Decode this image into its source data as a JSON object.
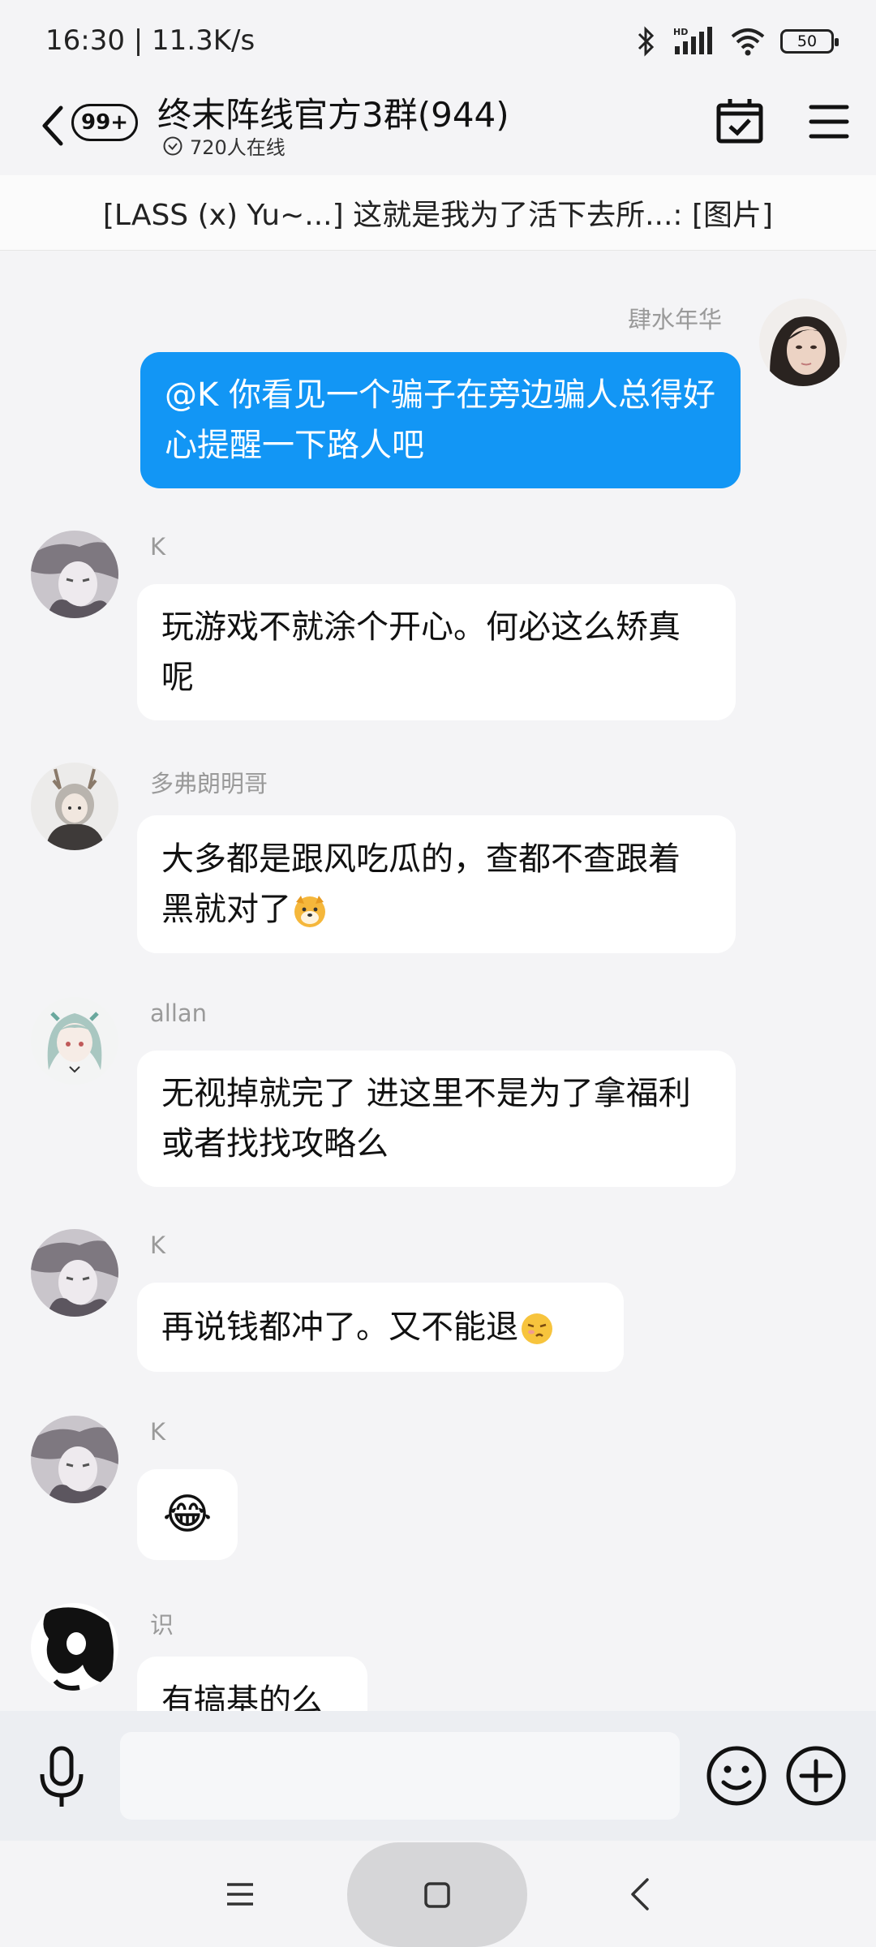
{
  "status_bar": {
    "time": "16:30 | 11.3K/s",
    "battery": "50"
  },
  "header": {
    "unread": "99+",
    "title": "终末阵线官方3群(944)",
    "online": "720人在线"
  },
  "pinned": {
    "text": "[LASS (x) Yu~...] 这就是我为了活下去所...: [图片]"
  },
  "messages": [
    {
      "sender": "肆水年华",
      "text": "@K 你看见一个骗子在旁边骗人总得好心提醒一下路人吧",
      "mine": true
    },
    {
      "sender": "K",
      "text": "玩游戏不就涂个开心。何必这么矫真呢"
    },
    {
      "sender": "多弗朗明哥",
      "text": "大多都是跟风吃瓜的，查都不查跟着黑就对了",
      "emoji": "dog-face-emoji"
    },
    {
      "sender": "allan",
      "text": "无视掉就完了 进这里不是为了拿福利或者找找攻略么"
    },
    {
      "sender": "K",
      "text": "再说钱都冲了。又不能退",
      "emoji": "pouting-face-emoji"
    },
    {
      "sender": "K",
      "text": "😂"
    },
    {
      "sender": "识",
      "text": "有搞基的么"
    }
  ],
  "input": {
    "placeholder": ""
  },
  "colors": {
    "my_bubble": "#1296f5",
    "background": "#f4f4f6",
    "input_bar": "#eceef2"
  },
  "icons": {
    "back": "chevron-left-icon",
    "online": "check-circle-icon",
    "calendar": "calendar-check-icon",
    "menu": "hamburger-menu-icon",
    "mic": "microphone-icon",
    "emoji": "smiley-icon",
    "plus": "plus-circle-icon"
  }
}
